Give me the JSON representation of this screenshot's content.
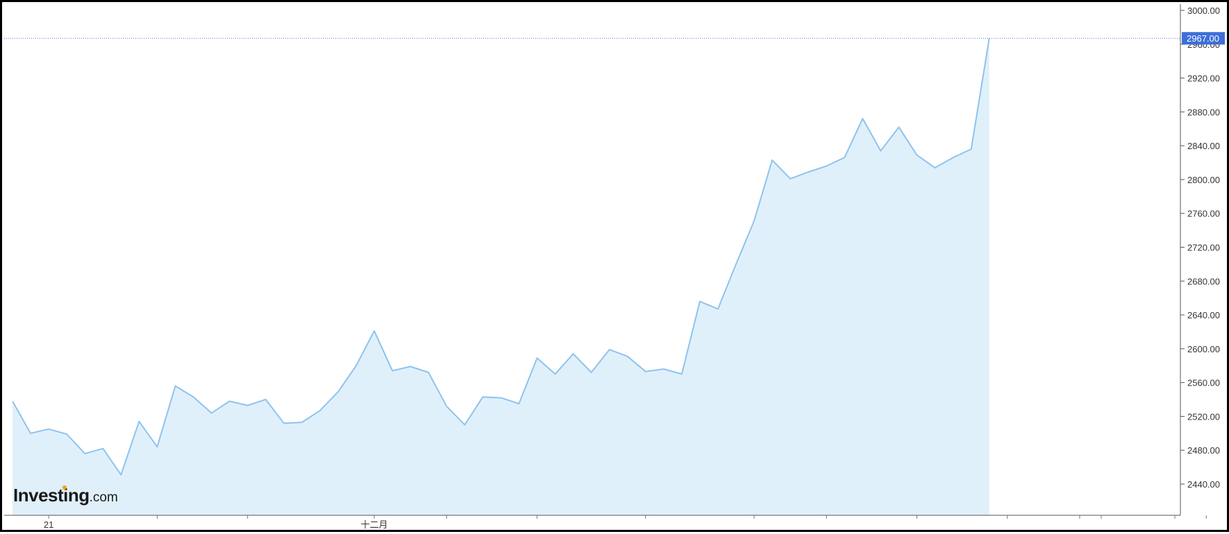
{
  "chart_data": {
    "type": "area",
    "title": "",
    "xlabel": "",
    "ylabel": "",
    "ylim": [
      2400,
      3000
    ],
    "yticks": [
      "2440.00",
      "2480.00",
      "2520.00",
      "2560.00",
      "2600.00",
      "2640.00",
      "2680.00",
      "2720.00",
      "2760.00",
      "2800.00",
      "2840.00",
      "2880.00",
      "2920.00",
      "2960.00",
      "3000.00"
    ],
    "x_labels": [
      {
        "index": 2,
        "label": "21"
      },
      {
        "index": 20,
        "label": "十二月"
      }
    ],
    "x_minor_ticks": [
      8,
      13,
      24,
      29,
      35,
      41,
      45,
      50,
      55,
      59,
      66,
      71
    ],
    "x_count": 64,
    "values": [
      2538,
      2500,
      2505,
      2499,
      2476,
      2482,
      2451,
      2514,
      2484,
      2556,
      2543,
      2524,
      2538,
      2533,
      2540,
      2512,
      2513,
      2527,
      2549,
      2580,
      2621,
      2574,
      2579,
      2572,
      2532,
      2510,
      2543,
      2542,
      2535,
      2589,
      2570,
      2594,
      2572,
      2599,
      2591,
      2573,
      2576,
      2570,
      2656,
      2647,
      2700,
      2751,
      2823,
      2801,
      2809,
      2816,
      2826,
      2872,
      2834,
      2862,
      2829,
      2814,
      2826,
      2836,
      2967
    ],
    "last_value": "2967.00",
    "grid": false,
    "line_color": "#8ec3ee",
    "fill_color": "#e0f0fa",
    "price_tag_color": "#3c6fd9"
  },
  "branding": {
    "logo_main": "Investing",
    "logo_suffix": ".com"
  }
}
